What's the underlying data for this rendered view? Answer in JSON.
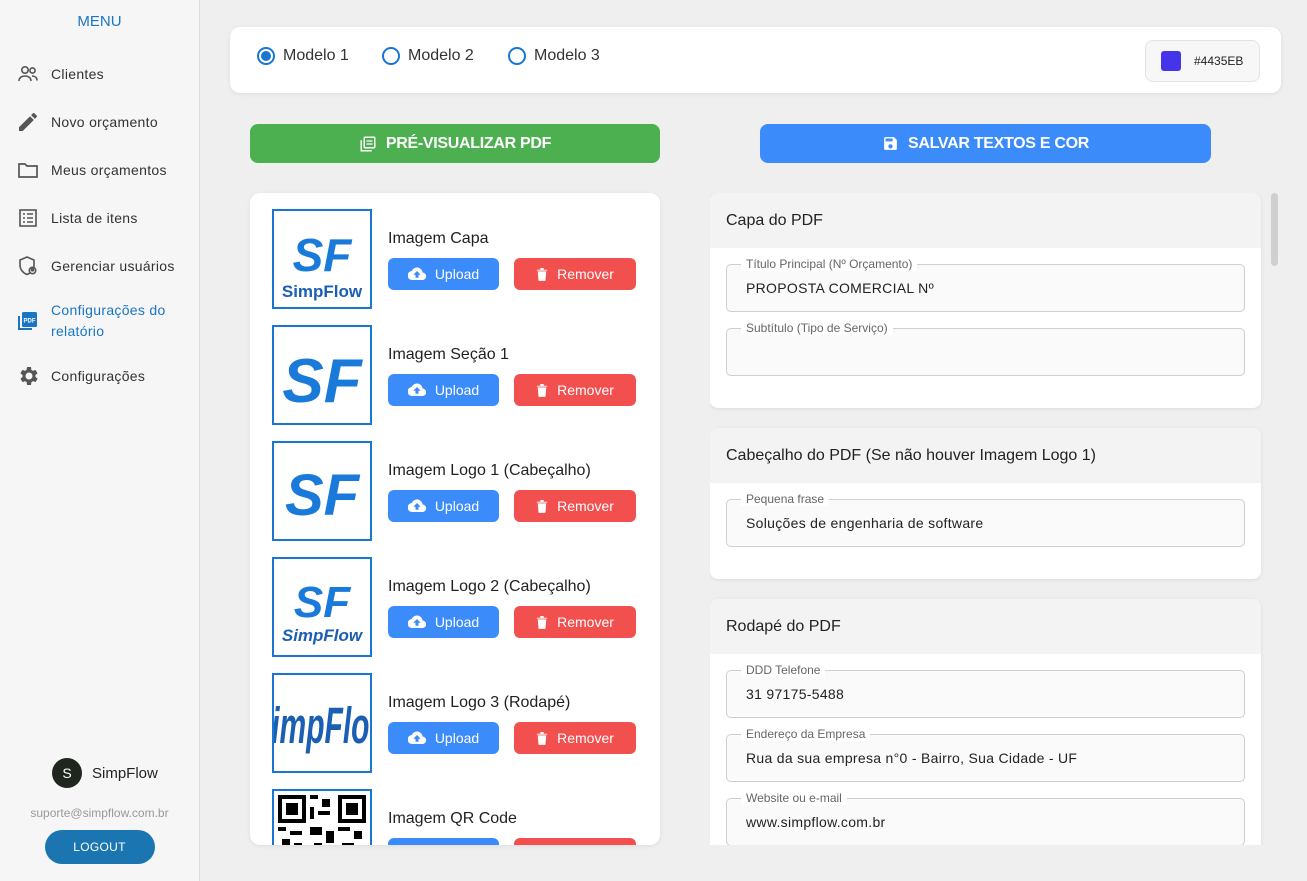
{
  "sidebar": {
    "menu_title": "MENU",
    "items": [
      {
        "label": "Clientes",
        "icon": "users-icon"
      },
      {
        "label": "Novo orçamento",
        "icon": "pencil-icon"
      },
      {
        "label": "Meus orçamentos",
        "icon": "folder-icon"
      },
      {
        "label": "Lista de itens",
        "icon": "list-icon"
      },
      {
        "label": "Gerenciar usuários",
        "icon": "user-shield-icon"
      },
      {
        "label": "Configurações do relatório",
        "icon": "pdf-icon",
        "active": true
      },
      {
        "label": "Configurações",
        "icon": "gear-icon"
      }
    ],
    "user": {
      "initial": "S",
      "name": "SimpFlow",
      "email": "suporte@simpflow.com.br"
    },
    "logout_label": "LOGOUT"
  },
  "models": {
    "options": [
      "Modelo 1",
      "Modelo 2",
      "Modelo 3"
    ],
    "selected": "Modelo 1"
  },
  "color": {
    "hex": "#4435EB",
    "label": "#4435EB"
  },
  "buttons": {
    "preview_label": "PRÉ-VISUALIZAR PDF",
    "save_label": "SALVAR TEXTOS E COR"
  },
  "images": {
    "upload_label": "Upload",
    "remove_label": "Remover",
    "items": [
      {
        "label": "Imagem Capa",
        "thumb": "sf-simpflow-logo"
      },
      {
        "label": "Imagem Seção 1",
        "thumb": "sf-logo"
      },
      {
        "label": "Imagem Logo 1 (Cabeçalho)",
        "thumb": "sf-logo"
      },
      {
        "label": "Imagem Logo 2 (Cabeçalho)",
        "thumb": "sf-simpflow-logo"
      },
      {
        "label": "Imagem Logo 3 (Rodapé)",
        "thumb": "simpflow-wordmark"
      },
      {
        "label": "Imagem QR Code",
        "thumb": "qr-code"
      }
    ]
  },
  "sections": {
    "cover": {
      "title": "Capa do PDF",
      "fields": [
        {
          "label": "Título Principal (Nº Orçamento)",
          "value": "PROPOSTA COMERCIAL Nº"
        },
        {
          "label": "Subtítulo (Tipo de Serviço)",
          "value": ""
        }
      ]
    },
    "header": {
      "title": "Cabeçalho do PDF (Se não houver Imagem Logo 1)",
      "fields": [
        {
          "label": "Pequena frase",
          "value": "Soluções de engenharia de software"
        }
      ]
    },
    "footer": {
      "title": "Rodapé do PDF",
      "fields": [
        {
          "label": "DDD Telefone",
          "value": "31 97175-5488"
        },
        {
          "label": "Endereço da Empresa",
          "value": "Rua da sua empresa n°0 - Bairro, Sua Cidade - UF"
        },
        {
          "label": "Website ou e-mail",
          "value": "www.simpflow.com.br"
        }
      ]
    }
  }
}
